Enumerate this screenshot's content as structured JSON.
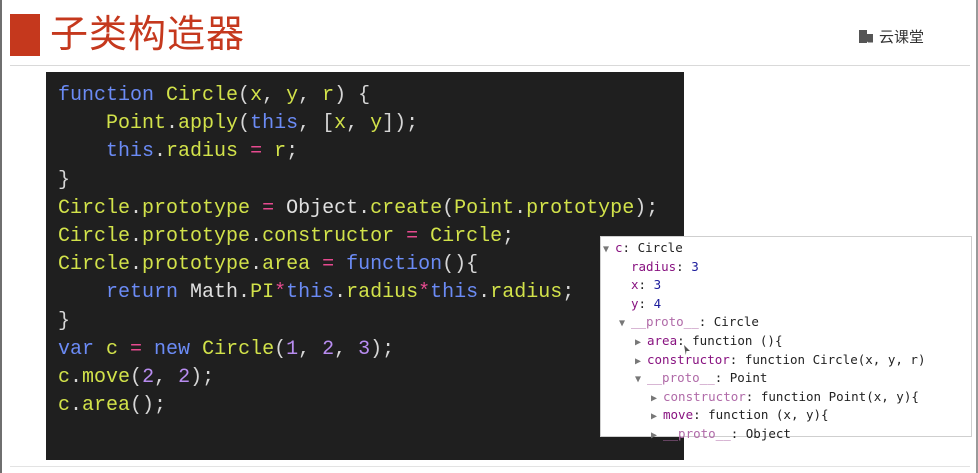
{
  "slide": {
    "title": "子类构造器",
    "logo_text": "云课堂",
    "side_note": "、,,,,"
  },
  "code": {
    "lines": [
      [
        {
          "t": "function ",
          "c": "kw"
        },
        {
          "t": "Circle",
          "c": "fn"
        },
        {
          "t": "(",
          "c": "pu"
        },
        {
          "t": "x",
          "c": "fn"
        },
        {
          "t": ", ",
          "c": "pu"
        },
        {
          "t": "y",
          "c": "fn"
        },
        {
          "t": ", ",
          "c": "pu"
        },
        {
          "t": "r",
          "c": "fn"
        },
        {
          "t": ") {",
          "c": "pu"
        }
      ],
      [
        {
          "t": "    ",
          "c": "pu"
        },
        {
          "t": "Point",
          "c": "fn"
        },
        {
          "t": ".",
          "c": "pu"
        },
        {
          "t": "apply",
          "c": "fn"
        },
        {
          "t": "(",
          "c": "pu"
        },
        {
          "t": "this",
          "c": "kw"
        },
        {
          "t": ", [",
          "c": "pu"
        },
        {
          "t": "x",
          "c": "fn"
        },
        {
          "t": ", ",
          "c": "pu"
        },
        {
          "t": "y",
          "c": "fn"
        },
        {
          "t": "]);",
          "c": "pu"
        }
      ],
      [
        {
          "t": "    ",
          "c": "pu"
        },
        {
          "t": "this",
          "c": "kw"
        },
        {
          "t": ".",
          "c": "pu"
        },
        {
          "t": "radius",
          "c": "fn"
        },
        {
          "t": " = ",
          "c": "op"
        },
        {
          "t": "r",
          "c": "fn"
        },
        {
          "t": ";",
          "c": "pu"
        }
      ],
      [
        {
          "t": "}",
          "c": "pu"
        }
      ],
      [
        {
          "t": "Circle",
          "c": "fn"
        },
        {
          "t": ".",
          "c": "pu"
        },
        {
          "t": "prototype",
          "c": "fn"
        },
        {
          "t": " = ",
          "c": "op"
        },
        {
          "t": "Object",
          "c": "id"
        },
        {
          "t": ".",
          "c": "pu"
        },
        {
          "t": "create",
          "c": "fn"
        },
        {
          "t": "(",
          "c": "pu"
        },
        {
          "t": "Point",
          "c": "fn"
        },
        {
          "t": ".",
          "c": "pu"
        },
        {
          "t": "prototype",
          "c": "fn"
        },
        {
          "t": ");",
          "c": "pu"
        }
      ],
      [
        {
          "t": "Circle",
          "c": "fn"
        },
        {
          "t": ".",
          "c": "pu"
        },
        {
          "t": "prototype",
          "c": "fn"
        },
        {
          "t": ".",
          "c": "pu"
        },
        {
          "t": "constructor",
          "c": "fn"
        },
        {
          "t": " = ",
          "c": "op"
        },
        {
          "t": "Circle",
          "c": "fn"
        },
        {
          "t": ";",
          "c": "pu"
        }
      ],
      [
        {
          "t": "Circle",
          "c": "fn"
        },
        {
          "t": ".",
          "c": "pu"
        },
        {
          "t": "prototype",
          "c": "fn"
        },
        {
          "t": ".",
          "c": "pu"
        },
        {
          "t": "area",
          "c": "fn"
        },
        {
          "t": " = ",
          "c": "op"
        },
        {
          "t": "function",
          "c": "kw"
        },
        {
          "t": "(){",
          "c": "pu"
        }
      ],
      [
        {
          "t": "    ",
          "c": "pu"
        },
        {
          "t": "return ",
          "c": "kw"
        },
        {
          "t": "Math",
          "c": "id"
        },
        {
          "t": ".",
          "c": "pu"
        },
        {
          "t": "PI",
          "c": "fn"
        },
        {
          "t": "*",
          "c": "op"
        },
        {
          "t": "this",
          "c": "kw"
        },
        {
          "t": ".",
          "c": "pu"
        },
        {
          "t": "radius",
          "c": "fn"
        },
        {
          "t": "*",
          "c": "op"
        },
        {
          "t": "this",
          "c": "kw"
        },
        {
          "t": ".",
          "c": "pu"
        },
        {
          "t": "radius",
          "c": "fn"
        },
        {
          "t": ";",
          "c": "pu"
        }
      ],
      [
        {
          "t": "}",
          "c": "pu"
        }
      ],
      [
        {
          "t": "var ",
          "c": "kw"
        },
        {
          "t": "c",
          "c": "fn"
        },
        {
          "t": " = ",
          "c": "op"
        },
        {
          "t": "new ",
          "c": "kw"
        },
        {
          "t": "Circle",
          "c": "fn"
        },
        {
          "t": "(",
          "c": "pu"
        },
        {
          "t": "1",
          "c": "nu"
        },
        {
          "t": ", ",
          "c": "pu"
        },
        {
          "t": "2",
          "c": "nu"
        },
        {
          "t": ", ",
          "c": "pu"
        },
        {
          "t": "3",
          "c": "nu"
        },
        {
          "t": ");",
          "c": "pu"
        }
      ],
      [
        {
          "t": "c",
          "c": "fn"
        },
        {
          "t": ".",
          "c": "pu"
        },
        {
          "t": "move",
          "c": "fn"
        },
        {
          "t": "(",
          "c": "pu"
        },
        {
          "t": "2",
          "c": "nu"
        },
        {
          "t": ", ",
          "c": "pu"
        },
        {
          "t": "2",
          "c": "nu"
        },
        {
          "t": ");",
          "c": "pu"
        }
      ],
      [
        {
          "t": "c",
          "c": "fn"
        },
        {
          "t": ".",
          "c": "pu"
        },
        {
          "t": "area",
          "c": "fn"
        },
        {
          "t": "();",
          "c": "pu"
        }
      ]
    ]
  },
  "console": {
    "rows": [
      {
        "level": 0,
        "arrow": "down",
        "parts": [
          {
            "t": "c",
            "c": "pk"
          },
          {
            "t": ": Circle",
            "c": "x"
          }
        ]
      },
      {
        "level": 1,
        "arrow": "",
        "parts": [
          {
            "t": "radius",
            "c": "pk"
          },
          {
            "t": ": ",
            "c": "x"
          },
          {
            "t": "3",
            "c": "pv"
          }
        ]
      },
      {
        "level": 1,
        "arrow": "",
        "parts": [
          {
            "t": "x",
            "c": "pk"
          },
          {
            "t": ": ",
            "c": "x"
          },
          {
            "t": "3",
            "c": "pv"
          }
        ]
      },
      {
        "level": 1,
        "arrow": "",
        "parts": [
          {
            "t": "y",
            "c": "pk"
          },
          {
            "t": ": ",
            "c": "x"
          },
          {
            "t": "4",
            "c": "pv"
          }
        ]
      },
      {
        "level": 1,
        "arrow": "down",
        "parts": [
          {
            "t": "__proto__",
            "c": "pkd"
          },
          {
            "t": ": Circle",
            "c": "x"
          }
        ]
      },
      {
        "level": 2,
        "arrow": "right",
        "parts": [
          {
            "t": "area",
            "c": "pk"
          },
          {
            "t": ": function (){",
            "c": "x"
          }
        ]
      },
      {
        "level": 2,
        "arrow": "right",
        "parts": [
          {
            "t": "constructor",
            "c": "pk"
          },
          {
            "t": ": function Circle(x, y, r)",
            "c": "x"
          }
        ]
      },
      {
        "level": 2,
        "arrow": "down",
        "parts": [
          {
            "t": "__proto__",
            "c": "pkd"
          },
          {
            "t": ": Point",
            "c": "x"
          }
        ]
      },
      {
        "level": 3,
        "arrow": "right",
        "parts": [
          {
            "t": "constructor",
            "c": "pkd"
          },
          {
            "t": ": function Point(x, y){",
            "c": "x"
          }
        ]
      },
      {
        "level": 3,
        "arrow": "right",
        "parts": [
          {
            "t": "move",
            "c": "pk"
          },
          {
            "t": ": function (x, y){",
            "c": "x"
          }
        ]
      },
      {
        "level": 3,
        "arrow": "right",
        "parts": [
          {
            "t": "__proto__",
            "c": "pkd"
          },
          {
            "t": ": Object",
            "c": "x"
          }
        ]
      }
    ]
  }
}
